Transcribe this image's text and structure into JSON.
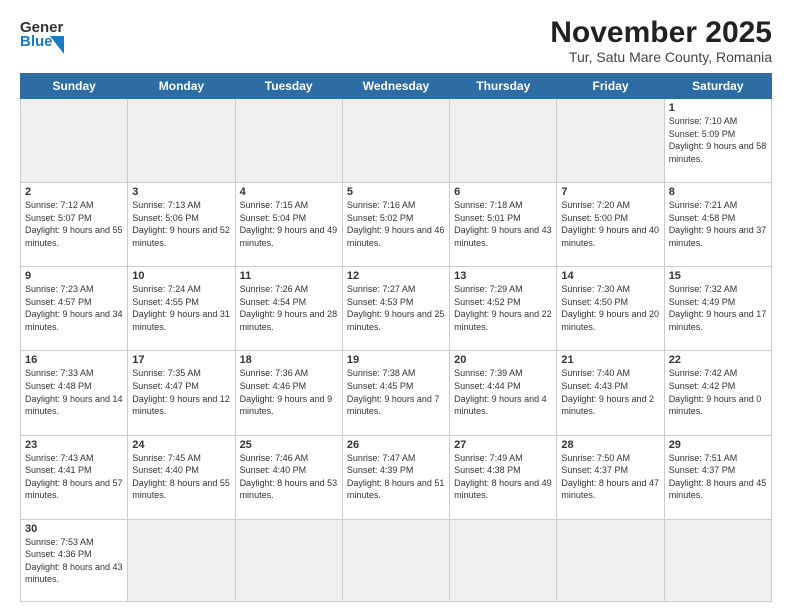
{
  "header": {
    "logo_general": "General",
    "logo_blue": "Blue",
    "month_title": "November 2025",
    "subtitle": "Tur, Satu Mare County, Romania"
  },
  "days_of_week": [
    "Sunday",
    "Monday",
    "Tuesday",
    "Wednesday",
    "Thursday",
    "Friday",
    "Saturday"
  ],
  "weeks": [
    [
      {
        "day": "",
        "empty": true
      },
      {
        "day": "",
        "empty": true
      },
      {
        "day": "",
        "empty": true
      },
      {
        "day": "",
        "empty": true
      },
      {
        "day": "",
        "empty": true
      },
      {
        "day": "",
        "empty": true
      },
      {
        "day": "1",
        "sunrise": "7:10 AM",
        "sunset": "5:09 PM",
        "daylight": "9 hours and 58 minutes."
      }
    ],
    [
      {
        "day": "2",
        "sunrise": "7:12 AM",
        "sunset": "5:07 PM",
        "daylight": "9 hours and 55 minutes."
      },
      {
        "day": "3",
        "sunrise": "7:13 AM",
        "sunset": "5:06 PM",
        "daylight": "9 hours and 52 minutes."
      },
      {
        "day": "4",
        "sunrise": "7:15 AM",
        "sunset": "5:04 PM",
        "daylight": "9 hours and 49 minutes."
      },
      {
        "day": "5",
        "sunrise": "7:16 AM",
        "sunset": "5:02 PM",
        "daylight": "9 hours and 46 minutes."
      },
      {
        "day": "6",
        "sunrise": "7:18 AM",
        "sunset": "5:01 PM",
        "daylight": "9 hours and 43 minutes."
      },
      {
        "day": "7",
        "sunrise": "7:20 AM",
        "sunset": "5:00 PM",
        "daylight": "9 hours and 40 minutes."
      },
      {
        "day": "8",
        "sunrise": "7:21 AM",
        "sunset": "4:58 PM",
        "daylight": "9 hours and 37 minutes."
      }
    ],
    [
      {
        "day": "9",
        "sunrise": "7:23 AM",
        "sunset": "4:57 PM",
        "daylight": "9 hours and 34 minutes."
      },
      {
        "day": "10",
        "sunrise": "7:24 AM",
        "sunset": "4:55 PM",
        "daylight": "9 hours and 31 minutes."
      },
      {
        "day": "11",
        "sunrise": "7:26 AM",
        "sunset": "4:54 PM",
        "daylight": "9 hours and 28 minutes."
      },
      {
        "day": "12",
        "sunrise": "7:27 AM",
        "sunset": "4:53 PM",
        "daylight": "9 hours and 25 minutes."
      },
      {
        "day": "13",
        "sunrise": "7:29 AM",
        "sunset": "4:52 PM",
        "daylight": "9 hours and 22 minutes."
      },
      {
        "day": "14",
        "sunrise": "7:30 AM",
        "sunset": "4:50 PM",
        "daylight": "9 hours and 20 minutes."
      },
      {
        "day": "15",
        "sunrise": "7:32 AM",
        "sunset": "4:49 PM",
        "daylight": "9 hours and 17 minutes."
      }
    ],
    [
      {
        "day": "16",
        "sunrise": "7:33 AM",
        "sunset": "4:48 PM",
        "daylight": "9 hours and 14 minutes."
      },
      {
        "day": "17",
        "sunrise": "7:35 AM",
        "sunset": "4:47 PM",
        "daylight": "9 hours and 12 minutes."
      },
      {
        "day": "18",
        "sunrise": "7:36 AM",
        "sunset": "4:46 PM",
        "daylight": "9 hours and 9 minutes."
      },
      {
        "day": "19",
        "sunrise": "7:38 AM",
        "sunset": "4:45 PM",
        "daylight": "9 hours and 7 minutes."
      },
      {
        "day": "20",
        "sunrise": "7:39 AM",
        "sunset": "4:44 PM",
        "daylight": "9 hours and 4 minutes."
      },
      {
        "day": "21",
        "sunrise": "7:40 AM",
        "sunset": "4:43 PM",
        "daylight": "9 hours and 2 minutes."
      },
      {
        "day": "22",
        "sunrise": "7:42 AM",
        "sunset": "4:42 PM",
        "daylight": "9 hours and 0 minutes."
      }
    ],
    [
      {
        "day": "23",
        "sunrise": "7:43 AM",
        "sunset": "4:41 PM",
        "daylight": "8 hours and 57 minutes."
      },
      {
        "day": "24",
        "sunrise": "7:45 AM",
        "sunset": "4:40 PM",
        "daylight": "8 hours and 55 minutes."
      },
      {
        "day": "25",
        "sunrise": "7:46 AM",
        "sunset": "4:40 PM",
        "daylight": "8 hours and 53 minutes."
      },
      {
        "day": "26",
        "sunrise": "7:47 AM",
        "sunset": "4:39 PM",
        "daylight": "8 hours and 51 minutes."
      },
      {
        "day": "27",
        "sunrise": "7:49 AM",
        "sunset": "4:38 PM",
        "daylight": "8 hours and 49 minutes."
      },
      {
        "day": "28",
        "sunrise": "7:50 AM",
        "sunset": "4:37 PM",
        "daylight": "8 hours and 47 minutes."
      },
      {
        "day": "29",
        "sunrise": "7:51 AM",
        "sunset": "4:37 PM",
        "daylight": "8 hours and 45 minutes."
      }
    ],
    [
      {
        "day": "30",
        "sunrise": "7:53 AM",
        "sunset": "4:36 PM",
        "daylight": "8 hours and 43 minutes."
      },
      {
        "day": "",
        "empty": true
      },
      {
        "day": "",
        "empty": true
      },
      {
        "day": "",
        "empty": true
      },
      {
        "day": "",
        "empty": true
      },
      {
        "day": "",
        "empty": true
      },
      {
        "day": "",
        "empty": true
      }
    ]
  ]
}
